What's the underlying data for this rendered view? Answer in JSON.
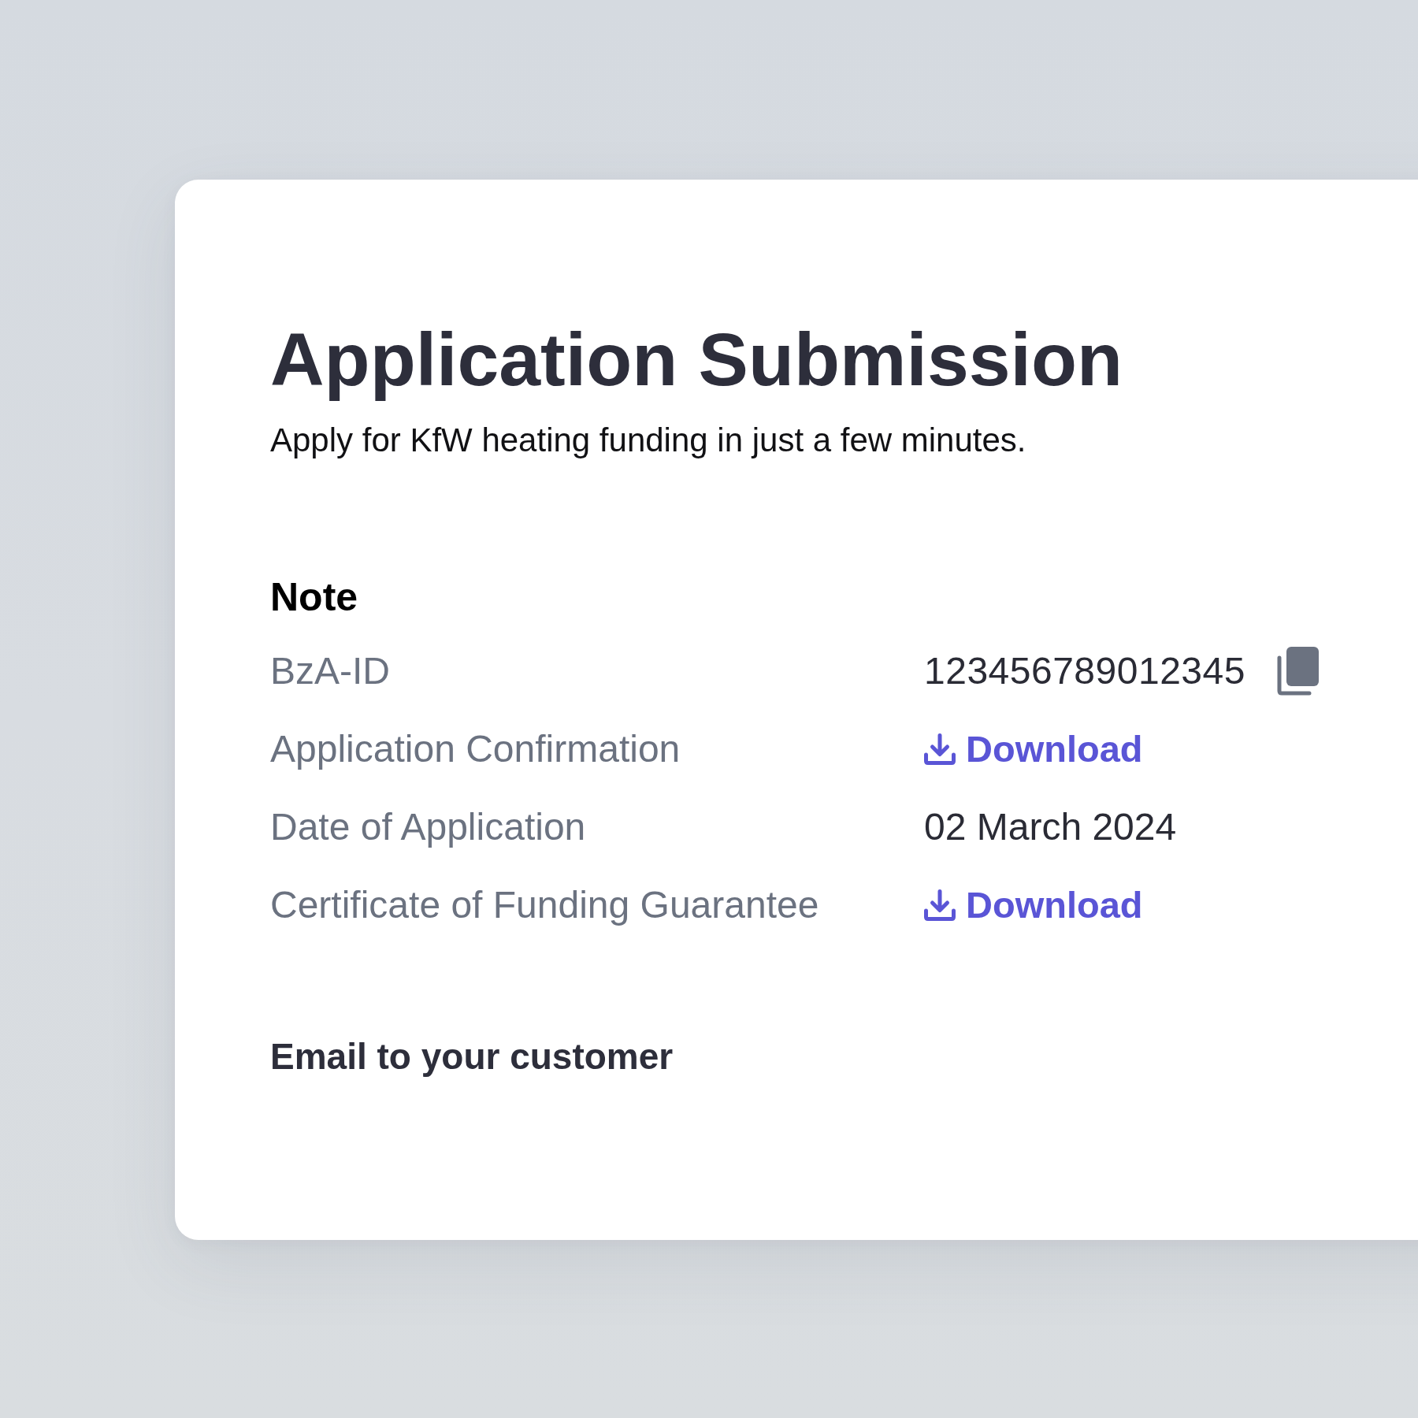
{
  "page": {
    "title": "Application Submission",
    "subtitle": "Apply for KfW heating funding in just a few minutes."
  },
  "note": {
    "heading": "Note",
    "rows": [
      {
        "label": "BzA-ID",
        "kind": "copyable",
        "value": "123456789012345"
      },
      {
        "label": "Application Confirmation",
        "kind": "download",
        "value": "Download"
      },
      {
        "label": "Date of Application",
        "kind": "text",
        "value": "02 March 2024"
      },
      {
        "label": "Certificate of Funding Guarantee",
        "kind": "download",
        "value": "Download"
      }
    ]
  },
  "email_section": {
    "heading": "Email to your customer"
  }
}
